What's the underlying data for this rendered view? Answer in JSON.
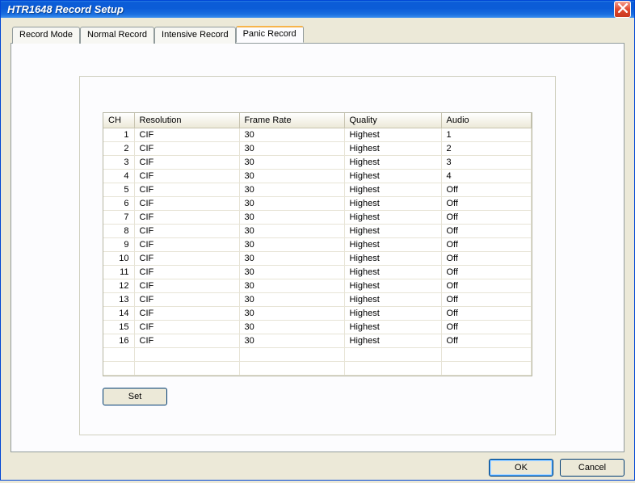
{
  "window": {
    "title": "HTR1648 Record Setup"
  },
  "tabs": [
    {
      "label": "Record Mode",
      "active": false
    },
    {
      "label": "Normal Record",
      "active": false
    },
    {
      "label": "Intensive Record",
      "active": false
    },
    {
      "label": "Panic Record",
      "active": true
    }
  ],
  "table": {
    "headers": {
      "ch": "CH",
      "resolution": "Resolution",
      "frame_rate": "Frame Rate",
      "quality": "Quality",
      "audio": "Audio"
    },
    "rows": [
      {
        "ch": "1",
        "resolution": "CIF",
        "frame_rate": "30",
        "quality": "Highest",
        "audio": "1"
      },
      {
        "ch": "2",
        "resolution": "CIF",
        "frame_rate": "30",
        "quality": "Highest",
        "audio": "2"
      },
      {
        "ch": "3",
        "resolution": "CIF",
        "frame_rate": "30",
        "quality": "Highest",
        "audio": "3"
      },
      {
        "ch": "4",
        "resolution": "CIF",
        "frame_rate": "30",
        "quality": "Highest",
        "audio": "4"
      },
      {
        "ch": "5",
        "resolution": "CIF",
        "frame_rate": "30",
        "quality": "Highest",
        "audio": "Off"
      },
      {
        "ch": "6",
        "resolution": "CIF",
        "frame_rate": "30",
        "quality": "Highest",
        "audio": "Off"
      },
      {
        "ch": "7",
        "resolution": "CIF",
        "frame_rate": "30",
        "quality": "Highest",
        "audio": "Off"
      },
      {
        "ch": "8",
        "resolution": "CIF",
        "frame_rate": "30",
        "quality": "Highest",
        "audio": "Off"
      },
      {
        "ch": "9",
        "resolution": "CIF",
        "frame_rate": "30",
        "quality": "Highest",
        "audio": "Off"
      },
      {
        "ch": "10",
        "resolution": "CIF",
        "frame_rate": "30",
        "quality": "Highest",
        "audio": "Off"
      },
      {
        "ch": "11",
        "resolution": "CIF",
        "frame_rate": "30",
        "quality": "Highest",
        "audio": "Off"
      },
      {
        "ch": "12",
        "resolution": "CIF",
        "frame_rate": "30",
        "quality": "Highest",
        "audio": "Off"
      },
      {
        "ch": "13",
        "resolution": "CIF",
        "frame_rate": "30",
        "quality": "Highest",
        "audio": "Off"
      },
      {
        "ch": "14",
        "resolution": "CIF",
        "frame_rate": "30",
        "quality": "Highest",
        "audio": "Off"
      },
      {
        "ch": "15",
        "resolution": "CIF",
        "frame_rate": "30",
        "quality": "Highest",
        "audio": "Off"
      },
      {
        "ch": "16",
        "resolution": "CIF",
        "frame_rate": "30",
        "quality": "Highest",
        "audio": "Off"
      }
    ],
    "empty_rows": 2
  },
  "buttons": {
    "set": "Set",
    "ok": "OK",
    "cancel": "Cancel"
  }
}
